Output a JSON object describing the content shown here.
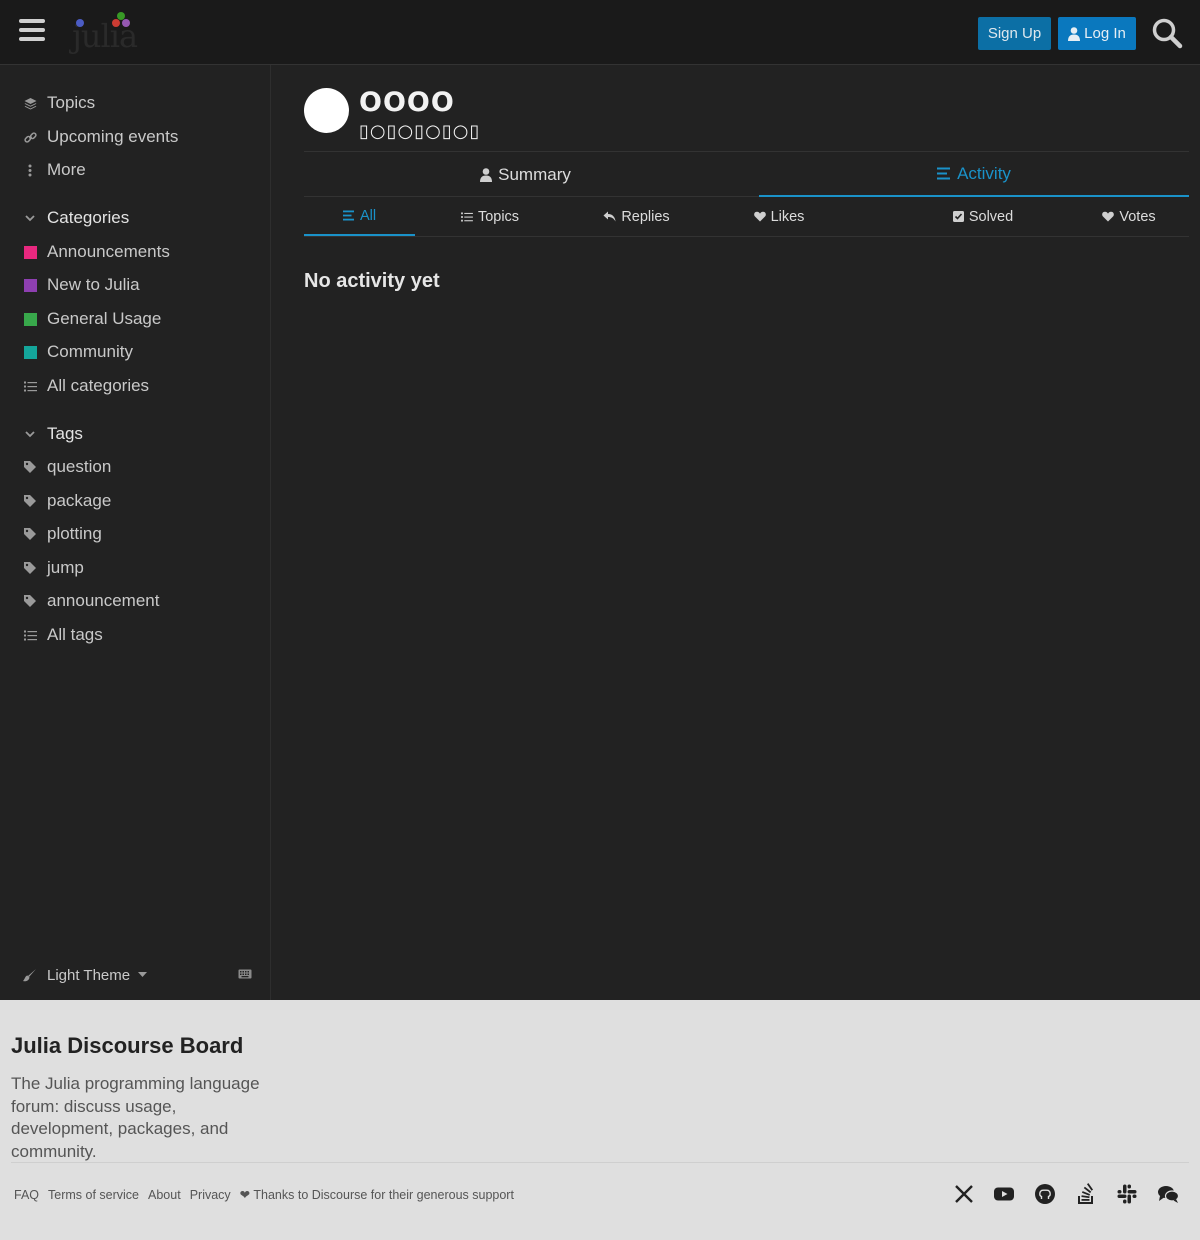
{
  "header": {
    "logo_text": "julia",
    "signup_label": "Sign Up",
    "login_label": "Log In"
  },
  "sidebar": {
    "top_items": [
      {
        "label": "Topics",
        "icon": "layers-icon"
      },
      {
        "label": "Upcoming events",
        "icon": "link-icon"
      },
      {
        "label": "More",
        "icon": "vertical-ellipsis-icon"
      }
    ],
    "categories_heading": "Categories",
    "categories": [
      {
        "label": "Announcements",
        "color": "#e8287f"
      },
      {
        "label": "New to Julia",
        "color": "#8e3fb1"
      },
      {
        "label": "General Usage",
        "color": "#38a84b"
      },
      {
        "label": "Community",
        "color": "#14a69b"
      },
      {
        "label": "All categories",
        "icon": "list-icon"
      }
    ],
    "tags_heading": "Tags",
    "tags": [
      {
        "label": "question"
      },
      {
        "label": "package"
      },
      {
        "label": "plotting"
      },
      {
        "label": "jump"
      },
      {
        "label": "announcement"
      },
      {
        "label": "All tags",
        "icon": "list-icon"
      }
    ],
    "theme_label": "Light Theme"
  },
  "profile": {
    "name": "OOOO",
    "subtitle": "▯○▯○▯○▯○▯"
  },
  "tabs": {
    "summary": "Summary",
    "activity": "Activity"
  },
  "subtabs": {
    "all": "All",
    "topics": "Topics",
    "replies": "Replies",
    "likes": "Likes",
    "solved": "Solved",
    "votes": "Votes"
  },
  "empty_message": "No activity yet",
  "footer": {
    "title": "Julia Discourse Board",
    "description": "The Julia programming language forum: discuss usage, development, packages, and community.",
    "links": {
      "faq": "FAQ",
      "tos": "Terms of service",
      "about": "About",
      "privacy": "Privacy",
      "thanks": "❤ Thanks to Discourse for their generous support"
    },
    "social_icons": [
      "x-icon",
      "youtube-icon",
      "github-icon",
      "stackoverflow-icon",
      "slack-icon",
      "chat-icon"
    ]
  },
  "colors": {
    "accent": "#1a92c9",
    "signup_bg": "#0c6fa5",
    "login_bg": "#0a78be"
  }
}
